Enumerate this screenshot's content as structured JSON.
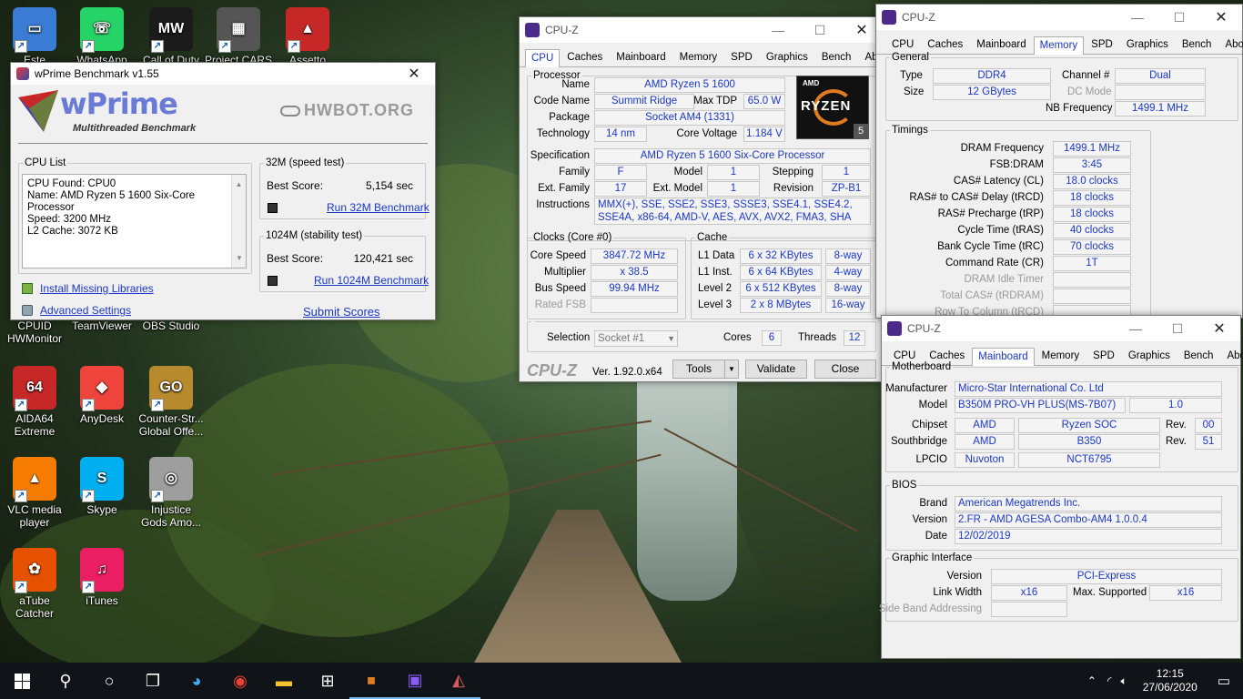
{
  "desktop": {
    "icons": [
      {
        "label": "Este",
        "color": "#3a7bd5",
        "glyph": "▭"
      },
      {
        "label": "WhatsApp",
        "color": "#25d366",
        "glyph": "☏"
      },
      {
        "label": "Call of Duty",
        "color": "#1b1b1b",
        "glyph": "MW"
      },
      {
        "label": "Project CARS",
        "color": "#555555",
        "glyph": "▦"
      },
      {
        "label": "Assetto",
        "color": "#c62828",
        "glyph": "▲"
      },
      {
        "label": "CPUID HWMonitor",
        "color": "#2e7d32",
        "glyph": "HW"
      },
      {
        "label": "TeamViewer",
        "color": "#0e8ee9",
        "glyph": "⇄"
      },
      {
        "label": "OBS Studio",
        "color": "#302e31",
        "glyph": "◉"
      },
      {
        "label": "AIDA64 Extreme",
        "color": "#c62828",
        "glyph": "64"
      },
      {
        "label": "AnyDesk",
        "color": "#ef443b",
        "glyph": "◆"
      },
      {
        "label": "Counter-Str... Global Offe...",
        "color": "#b88a2e",
        "glyph": "GO"
      },
      {
        "label": "VLC media player",
        "color": "#f57c00",
        "glyph": "▲"
      },
      {
        "label": "Skype",
        "color": "#00aff0",
        "glyph": "S"
      },
      {
        "label": "Injustice Gods Amo...",
        "color": "#9e9e9e",
        "glyph": "◎"
      },
      {
        "label": "aTube Catcher",
        "color": "#e65100",
        "glyph": "✿"
      },
      {
        "label": "iTunes",
        "color": "#e91e63",
        "glyph": "♫"
      }
    ]
  },
  "wprime": {
    "title": "wPrime Benchmark v1.55",
    "logo": "wPrime",
    "logo_sub": "Multithreaded Benchmark",
    "hwbot": "HWBOT.ORG",
    "cpu_list_legend": "CPU List",
    "cpu_list_lines": [
      "CPU Found: CPU0",
      "Name:   AMD Ryzen 5 1600 Six-Core",
      "Processor",
      "Speed:   3200 MHz",
      "L2 Cache: 3072 KB"
    ],
    "speed_legend": "32M (speed test)",
    "speed_best_label": "Best Score:",
    "speed_best_value": "5,154 sec",
    "speed_run": "Run 32M Benchmark",
    "stab_legend": "1024M (stability test)",
    "stab_best_label": "Best Score:",
    "stab_best_value": "120,421 sec",
    "stab_run": "Run 1024M Benchmark",
    "install_libs": "Install Missing Libraries",
    "advanced": "Advanced Settings",
    "submit": "Submit Scores"
  },
  "cpuz_cpu": {
    "title": "CPU-Z",
    "tabs": [
      "CPU",
      "Caches",
      "Mainboard",
      "Memory",
      "SPD",
      "Graphics",
      "Bench",
      "About"
    ],
    "active_tab": "CPU",
    "processor_legend": "Processor",
    "name_label": "Name",
    "name": "AMD Ryzen 5 1600",
    "codename_label": "Code Name",
    "codename": "Summit Ridge",
    "tdp_label": "Max TDP",
    "tdp": "65.0 W",
    "package_label": "Package",
    "package": "Socket AM4 (1331)",
    "tech_label": "Technology",
    "tech": "14 nm",
    "voltage_label": "Core Voltage",
    "voltage": "1.184 V",
    "spec_label": "Specification",
    "spec": "AMD Ryzen 5 1600 Six-Core Processor",
    "family_label": "Family",
    "family": "F",
    "model_label": "Model",
    "model": "1",
    "stepping_label": "Stepping",
    "stepping": "1",
    "extfamily_label": "Ext. Family",
    "extfamily": "17",
    "extmodel_label": "Ext. Model",
    "extmodel": "1",
    "revision_label": "Revision",
    "revision": "ZP-B1",
    "instr_label": "Instructions",
    "instr": "MMX(+), SSE, SSE2, SSE3, SSSE3, SSE4.1, SSE4.2, SSE4A, x86-64, AMD-V, AES, AVX, AVX2, FMA3, SHA",
    "badge_brand": "AMD",
    "badge_name": "RYZEN",
    "badge_num": "5",
    "clocks_legend": "Clocks (Core #0)",
    "corespeed_label": "Core Speed",
    "corespeed": "3847.72 MHz",
    "mult_label": "Multiplier",
    "mult": "x 38.5",
    "bus_label": "Bus Speed",
    "bus": "99.94 MHz",
    "fsb_label": "Rated FSB",
    "fsb": "",
    "cache_legend": "Cache",
    "l1d_label": "L1 Data",
    "l1d": "6 x 32 KBytes",
    "l1d_way": "8-way",
    "l1i_label": "L1 Inst.",
    "l1i": "6 x 64 KBytes",
    "l1i_way": "4-way",
    "l2_label": "Level 2",
    "l2": "6 x 512 KBytes",
    "l2_way": "8-way",
    "l3_label": "Level 3",
    "l3": "2 x 8 MBytes",
    "l3_way": "16-way",
    "selection_label": "Selection",
    "selection": "Socket #1",
    "cores_label": "Cores",
    "cores": "6",
    "threads_label": "Threads",
    "threads": "12",
    "brand": "CPU-Z",
    "version": "Ver. 1.92.0.x64",
    "tools": "Tools",
    "validate": "Validate",
    "close": "Close"
  },
  "cpuz_mem": {
    "title": "CPU-Z",
    "tabs": [
      "CPU",
      "Caches",
      "Mainboard",
      "Memory",
      "SPD",
      "Graphics",
      "Bench",
      "About"
    ],
    "active_tab": "Memory",
    "general_legend": "General",
    "type_label": "Type",
    "type": "DDR4",
    "channel_label": "Channel #",
    "channel": "Dual",
    "size_label": "Size",
    "size": "12 GBytes",
    "dcmode_label": "DC Mode",
    "dcmode": "",
    "nbfreq_label": "NB Frequency",
    "nbfreq": "1499.1 MHz",
    "timings_legend": "Timings",
    "rows": [
      {
        "label": "DRAM Frequency",
        "value": "1499.1 MHz",
        "dim": false
      },
      {
        "label": "FSB:DRAM",
        "value": "3:45",
        "dim": false
      },
      {
        "label": "CAS# Latency (CL)",
        "value": "18.0 clocks",
        "dim": false
      },
      {
        "label": "RAS# to CAS# Delay (tRCD)",
        "value": "18 clocks",
        "dim": false
      },
      {
        "label": "RAS# Precharge (tRP)",
        "value": "18 clocks",
        "dim": false
      },
      {
        "label": "Cycle Time (tRAS)",
        "value": "40 clocks",
        "dim": false
      },
      {
        "label": "Bank Cycle Time (tRC)",
        "value": "70 clocks",
        "dim": false
      },
      {
        "label": "Command Rate (CR)",
        "value": "1T",
        "dim": false
      },
      {
        "label": "DRAM Idle Timer",
        "value": "",
        "dim": true
      },
      {
        "label": "Total CAS# (tRDRAM)",
        "value": "",
        "dim": true
      },
      {
        "label": "Row To Column (tRCD)",
        "value": "",
        "dim": true
      }
    ]
  },
  "cpuz_mb": {
    "title": "CPU-Z",
    "tabs": [
      "CPU",
      "Caches",
      "Mainboard",
      "Memory",
      "SPD",
      "Graphics",
      "Bench",
      "About"
    ],
    "active_tab": "Mainboard",
    "mb_legend": "Motherboard",
    "manu_label": "Manufacturer",
    "manu": "Micro-Star International Co. Ltd",
    "model_label": "Model",
    "model": "B350M PRO-VH PLUS(MS-7B07)",
    "model_rev": "1.0",
    "chipset_label": "Chipset",
    "chipset_vendor": "AMD",
    "chipset": "Ryzen SOC",
    "chipset_rev_label": "Rev.",
    "chipset_rev": "00",
    "south_label": "Southbridge",
    "south_vendor": "AMD",
    "south": "B350",
    "south_rev_label": "Rev.",
    "south_rev": "51",
    "lpcio_label": "LPCIO",
    "lpcio_vendor": "Nuvoton",
    "lpcio": "NCT6795",
    "bios_legend": "BIOS",
    "brand_label": "Brand",
    "brand": "American Megatrends Inc.",
    "version_label": "Version",
    "version": "2.FR - AMD AGESA Combo-AM4 1.0.0.4",
    "date_label": "Date",
    "date": "12/02/2019",
    "gi_legend": "Graphic Interface",
    "gi_version_label": "Version",
    "gi_version": "PCI-Express",
    "linkwidth_label": "Link Width",
    "linkwidth": "x16",
    "maxsup_label": "Max. Supported",
    "maxsup": "x16",
    "sideband_label": "Side Band Addressing",
    "sideband": ""
  },
  "taskbar": {
    "time": "12:15",
    "date": "27/06/2020"
  }
}
